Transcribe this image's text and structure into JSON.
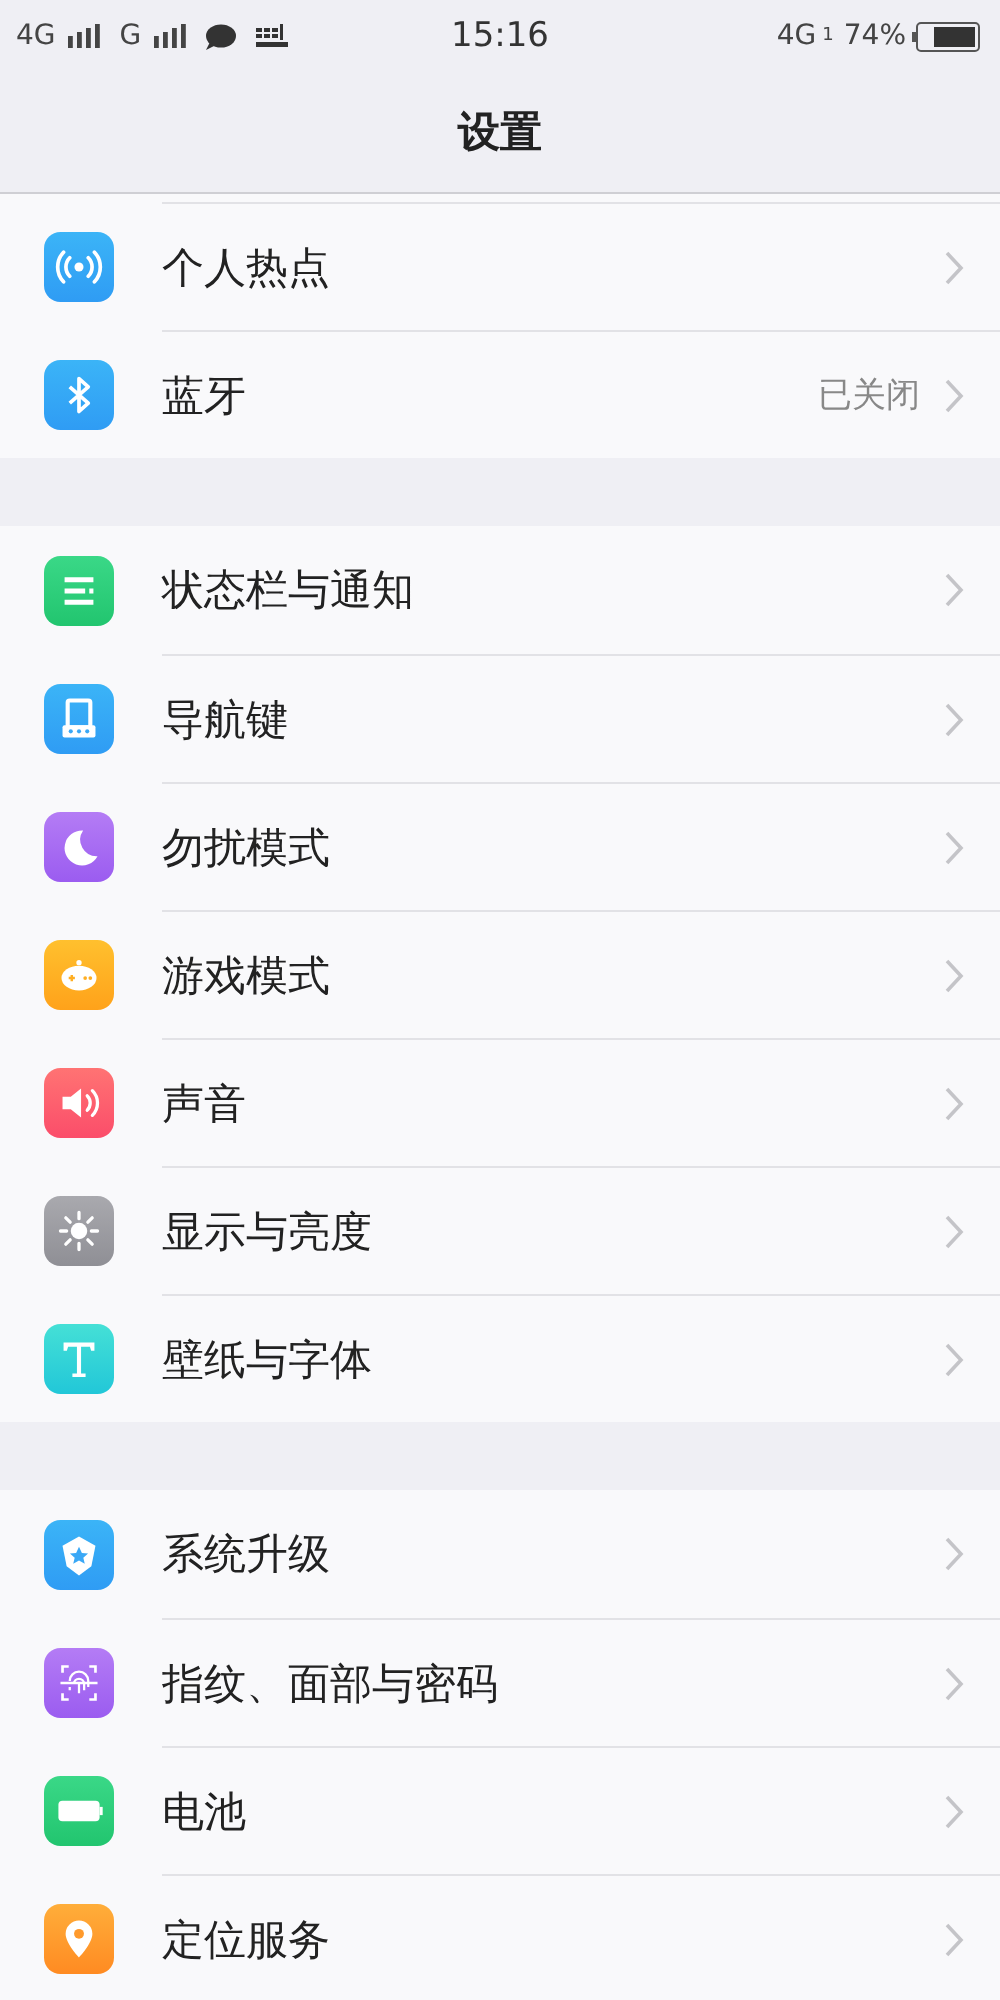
{
  "status_bar": {
    "left": [
      "4G",
      "G"
    ],
    "time": "15:16",
    "network": "4G",
    "sim": "1",
    "battery": "74%"
  },
  "title": "设置",
  "groups": [
    {
      "items": [
        {
          "label": "个人热点"
        },
        {
          "label": "蓝牙",
          "value": "已关闭"
        }
      ]
    },
    {
      "items": [
        {
          "label": "状态栏与通知"
        },
        {
          "label": "导航键"
        },
        {
          "label": "勿扰模式"
        },
        {
          "label": "游戏模式"
        },
        {
          "label": "声音"
        },
        {
          "label": "显示与亮度"
        },
        {
          "label": "壁纸与字体"
        }
      ]
    },
    {
      "items": [
        {
          "label": "系统升级"
        },
        {
          "label": "指纹、面部与密码"
        },
        {
          "label": "电池"
        },
        {
          "label": "定位服务"
        }
      ]
    }
  ]
}
